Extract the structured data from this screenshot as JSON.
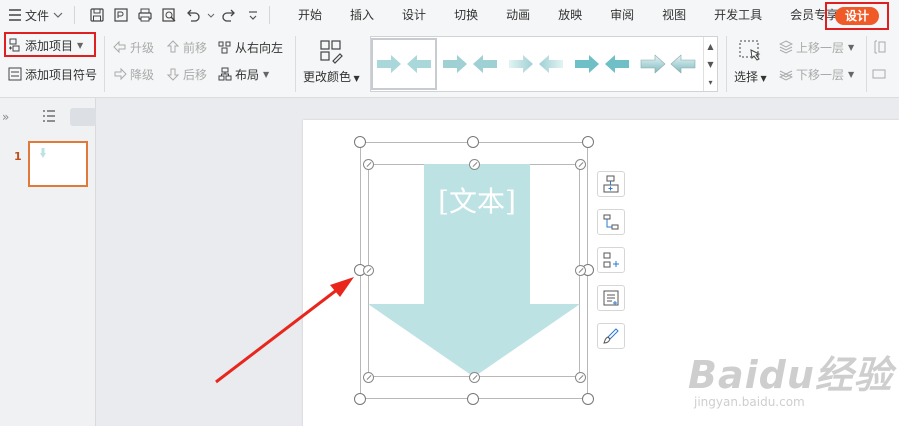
{
  "menubar": {
    "file_label": "文件",
    "tabs": [
      "开始",
      "插入",
      "设计",
      "切换",
      "动画",
      "放映",
      "审阅",
      "视图",
      "开发工具",
      "会员专享"
    ],
    "active_tab": "设计"
  },
  "ribbon": {
    "add_item": "添加项目",
    "add_item_bullet": "添加项目符号",
    "promote": "升级",
    "demote": "降级",
    "move_forward": "前移",
    "move_backward": "后移",
    "right_to_left": "从右向左",
    "layout": "布局",
    "change_colors": "更改颜色",
    "select": "选择",
    "bring_forward": "上移一层",
    "send_backward": "下移一层"
  },
  "sidebar": {
    "slide_number": "1"
  },
  "slide": {
    "arrow_text": "[文本]"
  },
  "watermark": {
    "logo": "Baidu经验",
    "url": "jingyan.baidu.com"
  },
  "colors": {
    "accent": "#f05a28",
    "highlight": "#e02020",
    "shape_fill": "#bde2e3",
    "annotation": "#e8261c"
  }
}
